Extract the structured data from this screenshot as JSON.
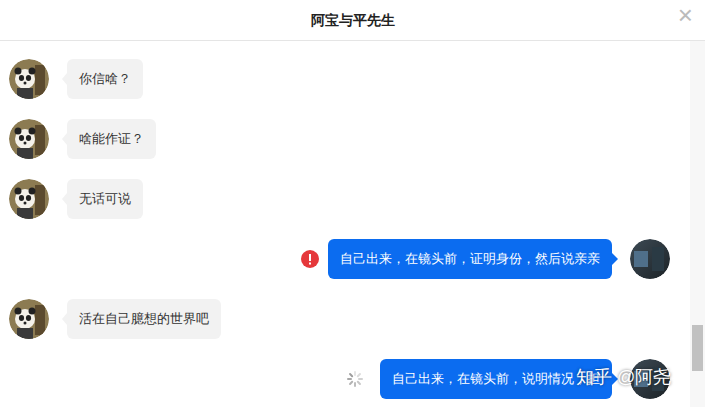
{
  "window": {
    "title": "阿宝与平先生",
    "close": "×"
  },
  "messages": [
    {
      "kind": "received",
      "text": "你信啥？",
      "status": "none"
    },
    {
      "kind": "received",
      "text": "啥能作证？",
      "status": "none"
    },
    {
      "kind": "received",
      "text": "无话可说",
      "status": "none"
    },
    {
      "kind": "sent",
      "text": "自己出来，在镜头前，证明身份，然后说亲亲",
      "status": "failed"
    },
    {
      "kind": "received",
      "text": "活在自己臆想的世界吧",
      "status": "none"
    },
    {
      "kind": "sent",
      "text": "自己出来，在镜头前，说明情况，担",
      "status": "sending"
    }
  ],
  "watermark": "知乎 @阿尧"
}
